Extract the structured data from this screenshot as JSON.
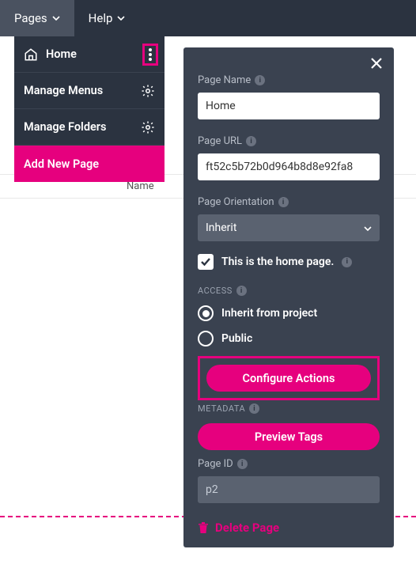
{
  "topbar": {
    "pages": "Pages",
    "help": "Help"
  },
  "sidebar": {
    "home": "Home",
    "manage_menus": "Manage Menus",
    "manage_folders": "Manage Folders",
    "add_new_page": "Add New Page"
  },
  "bg": {
    "name_col": "Name"
  },
  "panel": {
    "page_name_label": "Page Name",
    "page_name_value": "Home",
    "page_url_label": "Page URL",
    "page_url_value": "ft52c5b72b0d964b8d8e92fa8",
    "orientation_label": "Page Orientation",
    "orientation_value": "Inherit",
    "home_checkbox_label": "This is the home page.",
    "access_header": "ACCESS",
    "access_inherit": "Inherit from project",
    "access_public": "Public",
    "configure_actions": "Configure Actions",
    "metadata_header": "METADATA",
    "preview_tags": "Preview Tags",
    "page_id_label": "Page ID",
    "page_id_value": "p2",
    "delete_page": "Delete Page"
  }
}
